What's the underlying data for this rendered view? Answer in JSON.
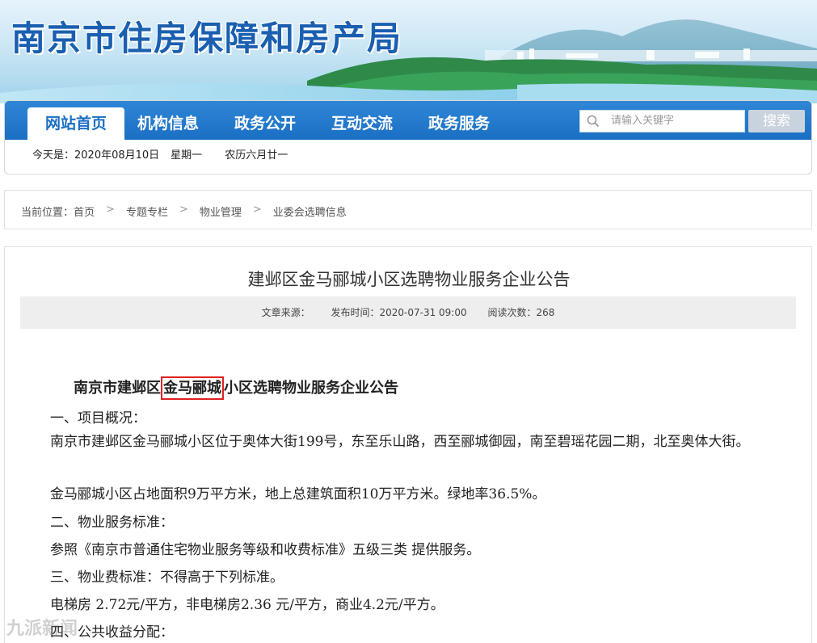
{
  "site": {
    "title": "南京市住房保障和房产局"
  },
  "nav": {
    "items": [
      {
        "label": "网站首页",
        "active": true
      },
      {
        "label": "机构信息"
      },
      {
        "label": "政务公开"
      },
      {
        "label": "互动交流"
      },
      {
        "label": "政务服务"
      }
    ],
    "search_placeholder": "请输入关键字",
    "search_button": "搜索"
  },
  "date": {
    "today_label": "今天是：2020年08月10日",
    "weekday": "星期一",
    "lunar": "农历六月廿一"
  },
  "breadcrumb": {
    "prefix": "当前位置：",
    "items": [
      "首页",
      "专题专栏",
      "物业管理",
      "业委会选聘信息"
    ],
    "separator": ">"
  },
  "article": {
    "title": "建邺区金马郦城小区选聘物业服务企业公告",
    "meta": {
      "source": "文章来源：",
      "published": "发布时间：2020-07-31 09:00",
      "views": "阅读次数：268"
    },
    "heading_before": "南京市建邺区",
    "heading_highlight": "金马郦城",
    "heading_after": "小区选聘物业服务企业公告",
    "paragraphs": [
      "一、项目概况：",
      "南京市建邺区金马郦城小区位于奥体大街199号，东至乐山路，西至郦城御园，南至碧瑶花园二期，北至奥体大街。",
      "金马郦城小区占地面积9万平方米，地上总建筑面积10万平方米。绿地率36.5%。",
      "二、物业服务标准：",
      "参照《南京市普通住宅物业服务等级和收费标准》五级三类 提供服务。",
      "三、物业费标准：不得高于下列标准。",
      "电梯房 2.72元/平方，非电梯房2.36 元/平方，商业4.2元/平方。",
      "四、公共收益分配："
    ]
  },
  "watermark": "九派新闻",
  "colors": {
    "brand_blue": "#1a6fc4",
    "highlight_red": "#e02020"
  }
}
